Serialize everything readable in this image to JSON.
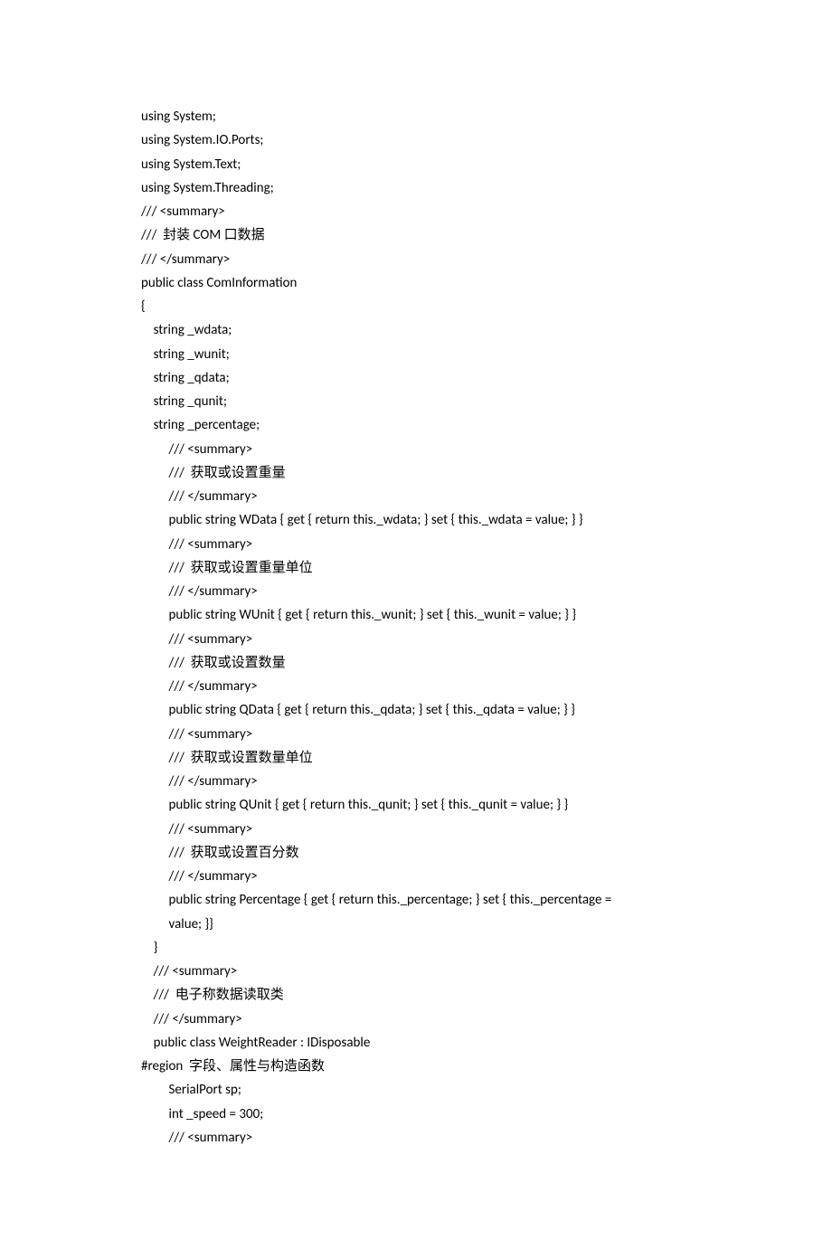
{
  "lines": [
    "using System;",
    "using System.IO.Ports;",
    "using System.Text;",
    "using System.Threading;",
    "/// <summary>",
    "///  封装 COM 口数据",
    "/// </summary>",
    "public class ComInformation",
    "{",
    "    string _wdata;",
    "    string _wunit;",
    "    string _qdata;",
    "    string _qunit;",
    "    string _percentage;",
    "         /// <summary>",
    "         ///  获取或设置重量",
    "         /// </summary>",
    "         public string WData { get { return this._wdata; } set { this._wdata = value; } }",
    "         /// <summary>",
    "         ///  获取或设置重量单位",
    "         /// </summary>",
    "         public string WUnit { get { return this._wunit; } set { this._wunit = value; } }",
    "         /// <summary>",
    "         ///  获取或设置数量",
    "         /// </summary>",
    "         public string QData { get { return this._qdata; } set { this._qdata = value; } }",
    "         /// <summary>",
    "         ///  获取或设置数量单位",
    "         /// </summary>",
    "         public string QUnit { get { return this._qunit; } set { this._qunit = value; } }",
    "         /// <summary>",
    "         ///  获取或设置百分数",
    "         /// </summary>",
    "         public string Percentage { get { return this._percentage; } set { this._percentage = ",
    "         value; }}",
    "    }",
    "    /// <summary>",
    "    ///  电子称数据读取类",
    "    /// </summary>",
    "    public class WeightReader : IDisposable",
    "#region  字段、属性与构造函数",
    "         SerialPort sp;",
    "         int _speed = 300;",
    "         /// <summary>"
  ]
}
